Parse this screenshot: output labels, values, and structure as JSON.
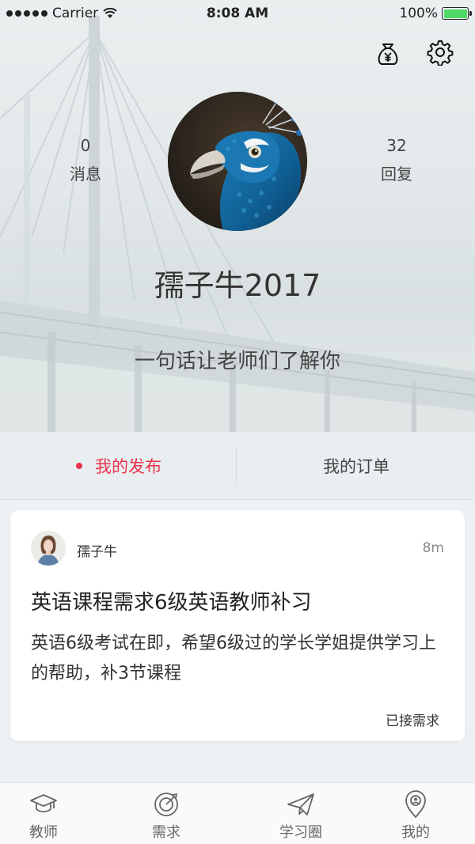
{
  "status_bar": {
    "carrier": "Carrier",
    "time": "8:08 AM",
    "battery": "100%"
  },
  "header": {
    "wallet_icon": "money-bag-yen-icon",
    "settings_icon": "gear-icon"
  },
  "profile": {
    "messages_count": "0",
    "messages_label": "消息",
    "replies_count": "32",
    "replies_label": "回复",
    "username": "孺子牛2017",
    "bio": "一句话让老师们了解你"
  },
  "tabs": [
    {
      "label": "我的发布",
      "active": true
    },
    {
      "label": "我的订单",
      "active": false
    }
  ],
  "post": {
    "author": "孺子牛",
    "time": "8m",
    "title": "英语课程需求6级英语教师补习",
    "body": "英语6级考试在即，希望6级过的学长学姐提供学习上的帮助，补3节课程",
    "status": "已接需求"
  },
  "tabbar": [
    {
      "label": "教师",
      "icon": "graduation-cap-icon"
    },
    {
      "label": "需求",
      "icon": "target-icon"
    },
    {
      "label": "学习圈",
      "icon": "paper-plane-icon"
    },
    {
      "label": "我的",
      "icon": "profile-pin-icon"
    }
  ],
  "colors": {
    "accent": "#e8334a",
    "battery": "#4cd964"
  }
}
